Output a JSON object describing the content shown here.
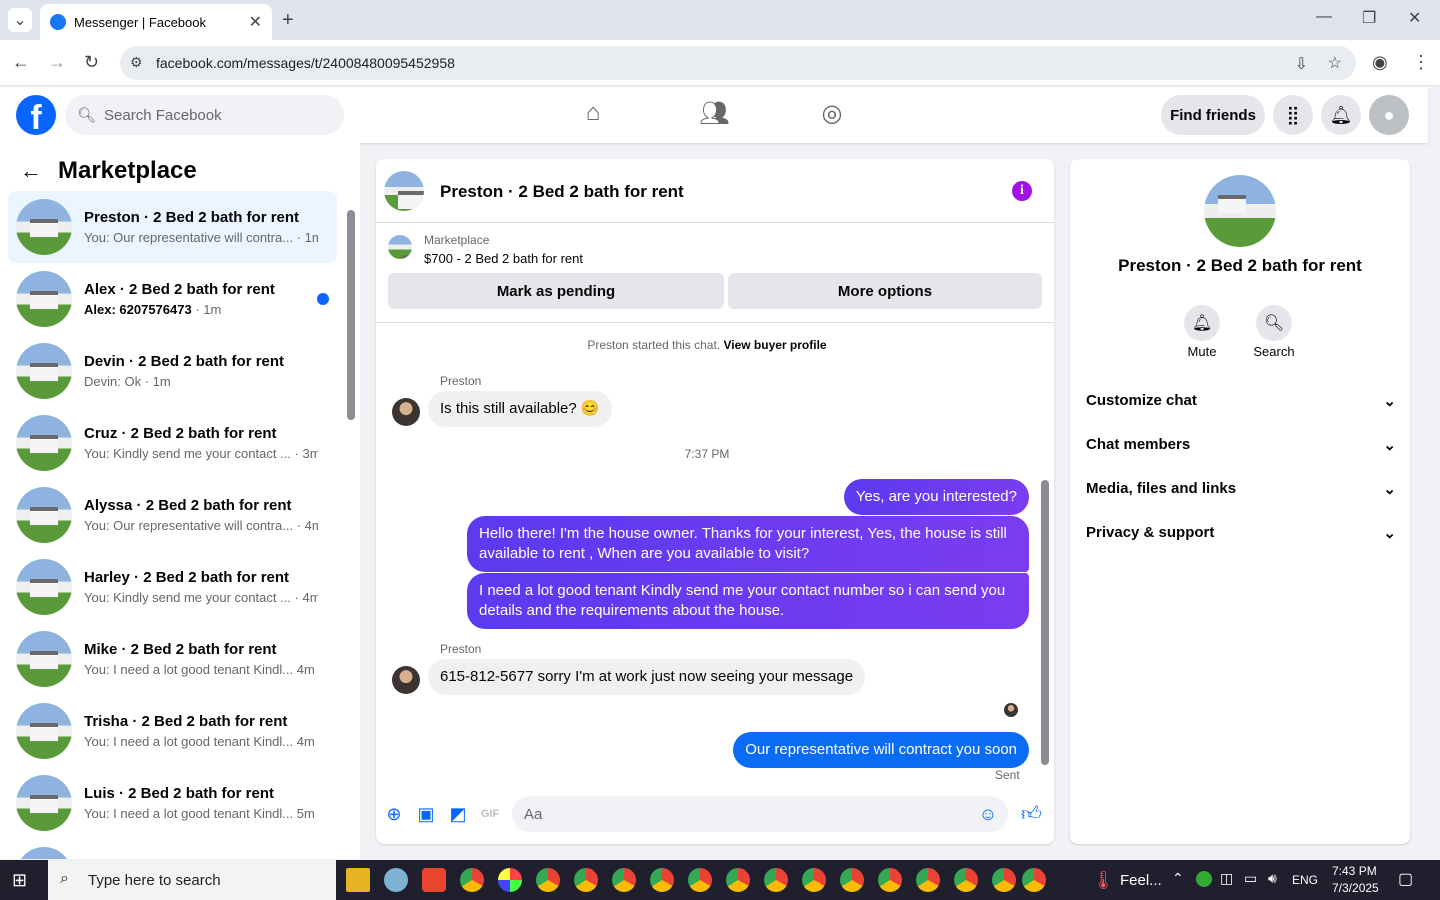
{
  "browser": {
    "tab_title": "Messenger | Facebook",
    "url": "facebook.com/messages/t/24008480095452958"
  },
  "fb": {
    "logo": "f",
    "search_placeholder": "Search Facebook",
    "find_friends": "Find friends"
  },
  "left": {
    "title": "Marketplace",
    "conversations": [
      {
        "name": "Preston · 2 Bed 2 bath for rent",
        "preview": "You: Our representative will contra...",
        "time": "· 1m"
      },
      {
        "name": "Alex · 2 Bed 2 bath for rent",
        "preview": "Alex: 6207576473",
        "time": "· 1m"
      },
      {
        "name": "Devin · 2 Bed 2 bath for rent",
        "preview": "Devin: Ok",
        "time": "· 1m"
      },
      {
        "name": "Cruz · 2 Bed 2 bath for rent",
        "preview": "You: Kindly send me your contact ...",
        "time": "· 3m"
      },
      {
        "name": "Alyssa · 2 Bed 2 bath for rent",
        "preview": "You: Our representative will contra...",
        "time": "· 4m"
      },
      {
        "name": "Harley · 2 Bed 2 bath for rent",
        "preview": "You: Kindly send me your contact ...",
        "time": "· 4m"
      },
      {
        "name": "Mike · 2 Bed 2 bath for rent",
        "preview": "You: I need a lot good tenant Kindl...",
        "time": "4m"
      },
      {
        "name": "Trisha · 2 Bed 2 bath for rent",
        "preview": "You: I need a lot good tenant Kindl...",
        "time": "4m"
      },
      {
        "name": "Luis · 2 Bed 2 bath for rent",
        "preview": "You: I need a lot good tenant Kindl...",
        "time": "5m"
      }
    ]
  },
  "chat": {
    "title": "Preston · 2 Bed 2 bath for rent",
    "marketplace_label": "Marketplace",
    "listing": "$700 - 2 Bed 2 bath for rent",
    "mark_pending": "Mark as pending",
    "more_options": "More options",
    "started": "Preston started this chat.",
    "view_buyer": "View buyer profile",
    "sender": "Preston",
    "msg1": "Is this still available? 😊",
    "timestamp": "7:37 PM",
    "msg2": "Yes, are you interested?",
    "msg3": "Hello there! I'm the house owner. Thanks for your interest, Yes, the house is still available to rent , When are you available to visit?",
    "msg4": "I need a lot good tenant Kindly send me your contact number so i can send you details and the requirements about the house.",
    "msg5": "615-812-5677 sorry I'm at work just now seeing your message",
    "msg6": "Our representative will contract you soon",
    "sent": "Sent",
    "input_placeholder": "Aa"
  },
  "right": {
    "name": "Preston · 2 Bed 2 bath for rent",
    "mute": "Mute",
    "search": "Search",
    "sections": [
      "Customize chat",
      "Chat members",
      "Media, files and links",
      "Privacy & support"
    ]
  },
  "taskbar": {
    "search_placeholder": "Type here to search",
    "weather": "Feel...",
    "lang": "ENG",
    "time": "7:43 PM",
    "date": "7/3/2025"
  }
}
